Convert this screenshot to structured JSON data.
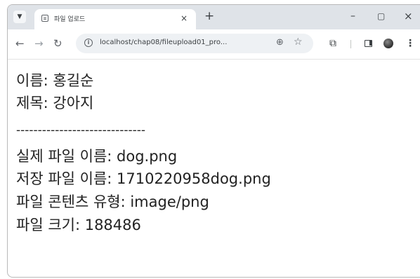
{
  "browser": {
    "tab_title": "파일 업로드",
    "tab_close": "×",
    "new_tab": "+",
    "window_minimize": "–",
    "window_maximize": "▢",
    "window_close": "×",
    "url": "localhost/chap08/fileupload01_pro...",
    "icons": {
      "tab_list": "chevron-down-icon",
      "favicon": "page-icon",
      "back": "arrow-left-icon",
      "forward": "arrow-right-icon",
      "reload": "reload-icon",
      "site_info": "info-icon",
      "zoom": "zoom-icon",
      "bookmark": "star-icon",
      "extensions": "puzzle-icon",
      "side_panel": "side-panel-icon",
      "profile": "avatar-icon",
      "menu": "kebab-menu-icon"
    }
  },
  "content": {
    "lines": [
      "이름: 홍길순",
      "제목: 강아지",
      "------------------------------",
      "실제 파일 이름: dog.png",
      "저장 파일 이름: 1710220958dog.png",
      "파일 콘텐츠 유형: image/png",
      "파일 크기: 188486"
    ]
  }
}
